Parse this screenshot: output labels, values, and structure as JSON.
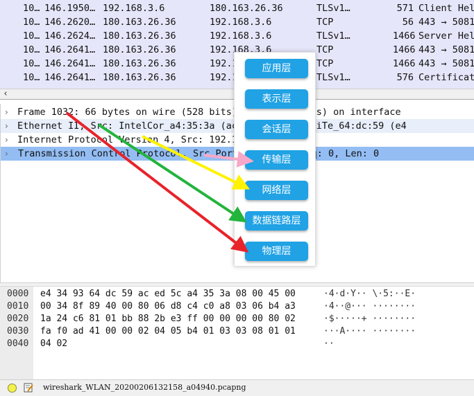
{
  "packet_list": {
    "rows": [
      {
        "no": "10…",
        "time": "146.1950…",
        "source": "192.168.3.6",
        "destination": "180.163.26.36",
        "protocol": "TLSv1…",
        "length": "571",
        "info": "Client Hel"
      },
      {
        "no": "10…",
        "time": "146.2620…",
        "source": "180.163.26.36",
        "destination": "192.168.3.6",
        "protocol": "TCP",
        "length": "56",
        "info": "443 → 5081"
      },
      {
        "no": "10…",
        "time": "146.2624…",
        "source": "180.163.26.36",
        "destination": "192.168.3.6",
        "protocol": "TLSv1…",
        "length": "1466",
        "info": "Server Hel"
      },
      {
        "no": "10…",
        "time": "146.2641…",
        "source": "180.163.26.36",
        "destination": "192.168.3.6",
        "protocol": "TCP",
        "length": "1466",
        "info": "443 → 5081"
      },
      {
        "no": "10…",
        "time": "146.2641…",
        "source": "180.163.26.36",
        "destination": "192.1",
        "protocol": "TCP",
        "length": "1466",
        "info": "443 → 5081"
      },
      {
        "no": "10…",
        "time": "146.2641…",
        "source": "180.163.26.36",
        "destination": "192.1",
        "protocol": "TLSv1…",
        "length": "576",
        "info": "Certificat"
      }
    ],
    "row_colors": {
      "background": "#e6e6fa"
    }
  },
  "details": {
    "rows": [
      {
        "text": "Frame 1032: 66 bytes on wire (528 bits)                 ured (528 bits) on interface"
      },
      {
        "text": "Ethernet II, Src: IntelCor_a4:35:3a (ac                 ), Dst: HuaweiTe_64:dc:59 (e4"
      },
      {
        "text": "Internet Protocol Version 4, Src: 192.1               80.163.26.36"
      },
      {
        "text": "Transmission Control Protocol, Src Port              ort: 443, Seq: 0, Len: 0"
      }
    ],
    "expand_glyph": "›",
    "selected_color": "#93bdf3"
  },
  "bytes": {
    "rows": [
      {
        "offset": "0000",
        "hex": "e4 34 93 64 dc 59 ac ed  5c a4 35 3a 08 00 45 00",
        "ascii": "·4·d·Y·· \\·5:··E·"
      },
      {
        "offset": "0010",
        "hex": "00 34 8f 89 40 00 80 06  d8 c4 c0 a8 03 06 b4 a3",
        "ascii": "·4··@··· ········"
      },
      {
        "offset": "0020",
        "hex": "1a 24 c6 81 01 bb 88 2b  e3 ff 00 00 00 00 80 02",
        "ascii": "·$·····+ ········"
      },
      {
        "offset": "0030",
        "hex": "fa f0 ad 41 00 00 02 04  05 b4 01 03 03 08 01 01",
        "ascii": "···A···· ········"
      },
      {
        "offset": "0040",
        "hex": "04 02",
        "ascii": "··"
      }
    ]
  },
  "status_bar": {
    "file_name": "wireshark_WLAN_20200206132158_a04940.pcapng",
    "led_color": "#f4f24a",
    "icons": [
      "status-led-icon",
      "edit-note-icon"
    ]
  },
  "osi_layers": {
    "buttons": [
      {
        "label": "应用层"
      },
      {
        "label": "表示层"
      },
      {
        "label": "会话层"
      },
      {
        "label": "传输层"
      },
      {
        "label": "网络层"
      },
      {
        "label": "数据链路层"
      },
      {
        "label": "物理层"
      }
    ],
    "button_color": "#20a2e5",
    "arrow_colors": {
      "physical": "#e8232a",
      "data_link": "#23b43c",
      "network": "#fff200",
      "transport": "#f7a8c8"
    }
  },
  "scroll": {
    "left_glyph": "‹"
  }
}
